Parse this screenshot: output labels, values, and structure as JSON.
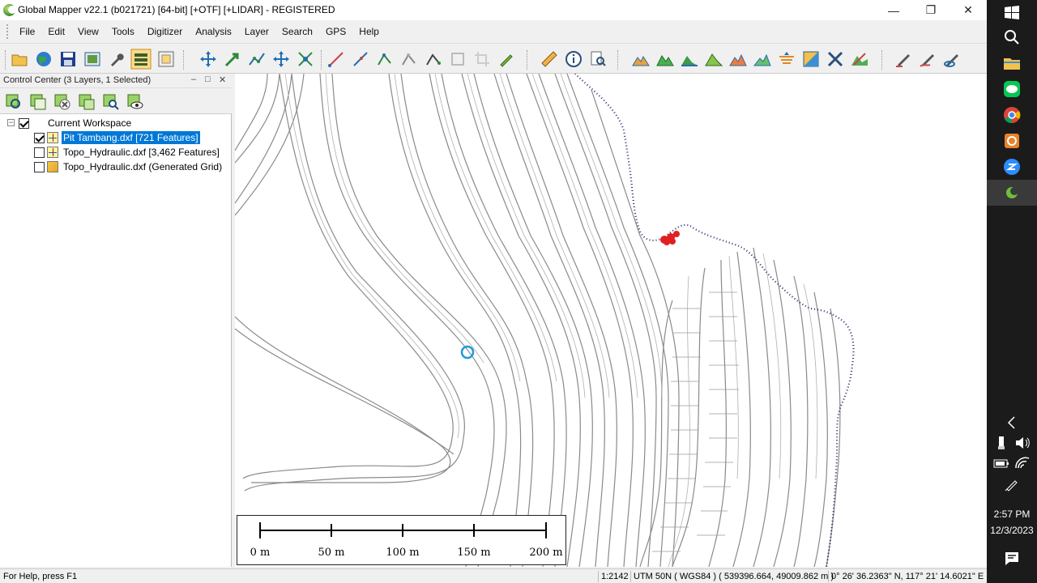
{
  "window": {
    "title": "Global Mapper v22.1 (b021721) [64-bit] [+OTF] [+LIDAR] - REGISTERED",
    "minimize": "—",
    "maximize": "❐",
    "close": "✕"
  },
  "menu": [
    "File",
    "Edit",
    "View",
    "Tools",
    "Digitizer",
    "Analysis",
    "Layer",
    "Search",
    "GPS",
    "Help"
  ],
  "control_center": {
    "title": "Control Center (3 Layers, 1 Selected)",
    "pin": "–",
    "restore": "□",
    "close": "✕",
    "workspace_label": "Current Workspace",
    "layers": [
      {
        "name": "Pit Tambang.dxf [721 Features]",
        "checked": true,
        "selected": true,
        "icon": "vector-layer-icon"
      },
      {
        "name": "Topo_Hydraulic.dxf [3,462 Features]",
        "checked": false,
        "selected": false,
        "icon": "vector-layer-icon"
      },
      {
        "name": "Topo_Hydraulic.dxf (Generated Grid)",
        "checked": false,
        "selected": false,
        "icon": "grid-layer-icon"
      }
    ]
  },
  "scale_bar": {
    "labels": [
      "0 m",
      "50 m",
      "100 m",
      "150 m",
      "200 m"
    ]
  },
  "status": {
    "help": "For Help, press F1",
    "scale": "1:2142",
    "projection": "UTM 50N ( WGS84 ) ( 539396.664, 49009.862 m )",
    "latlon": "0° 26' 36.2363\" N, 117° 21' 14.6021\" E"
  },
  "taskbar": {
    "time": "2:57 PM",
    "date": "12/3/2023"
  },
  "colors": {
    "selection": "#0078d7",
    "boundary": "#2b2b6e",
    "highlight": "#e02020",
    "cursor": "#1e9bd7"
  }
}
